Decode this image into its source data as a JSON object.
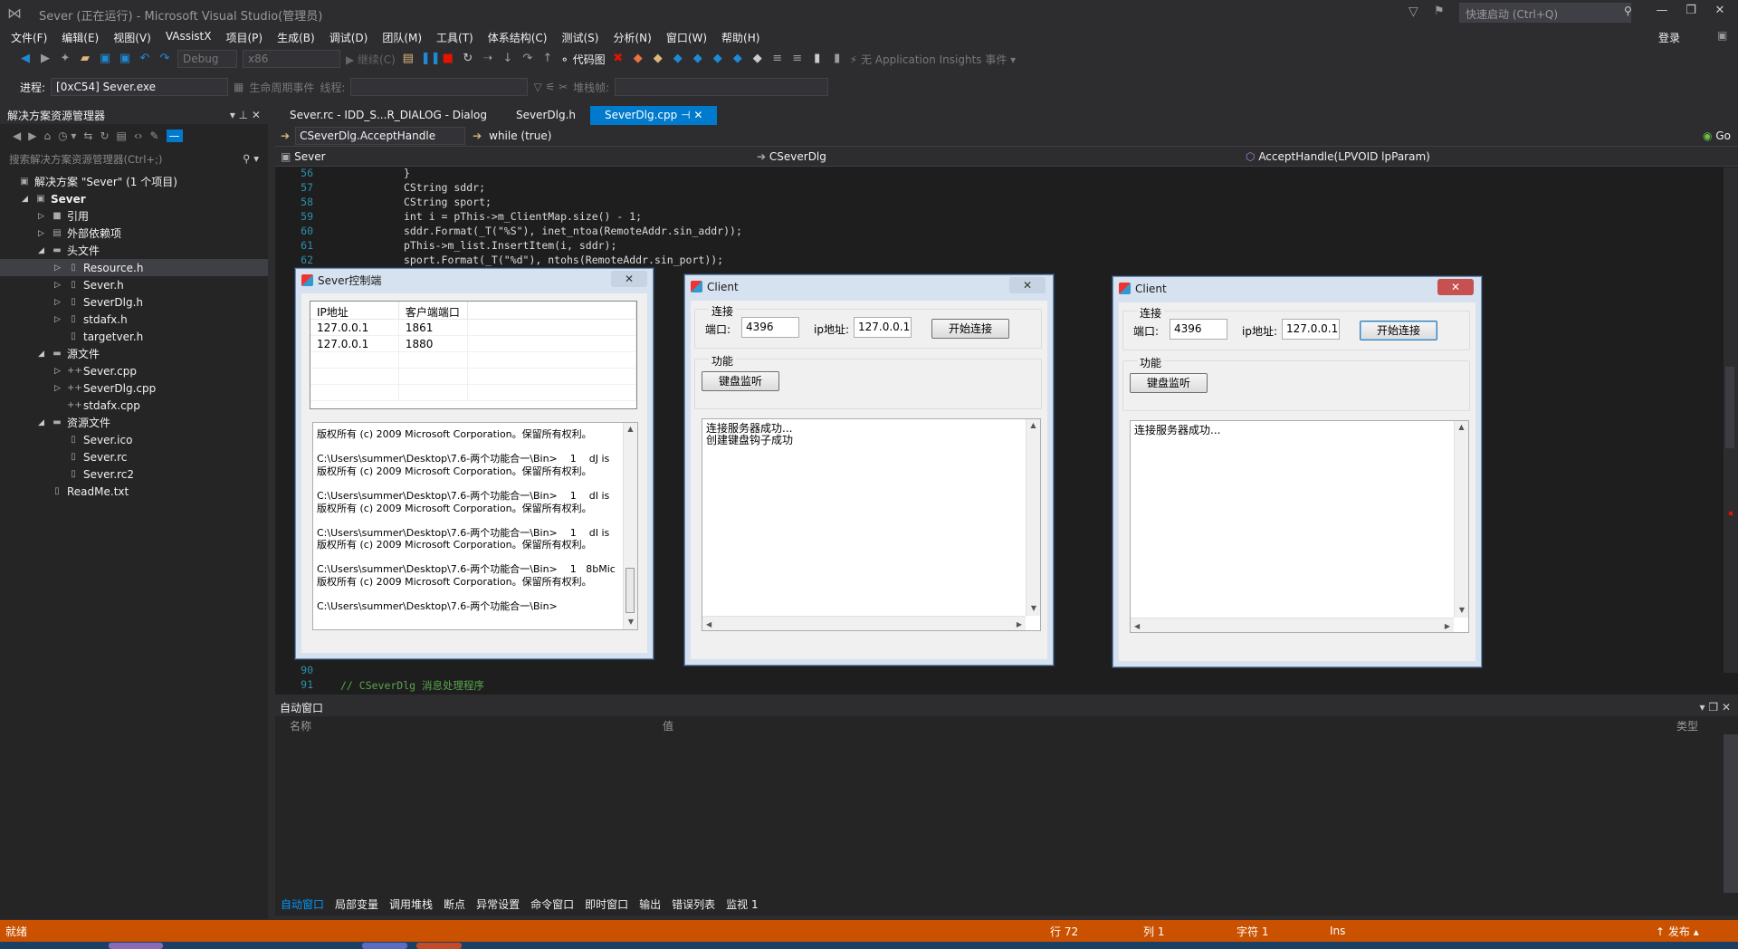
{
  "window": {
    "title": "Sever (正在运行) - Microsoft Visual Studio(管理员)",
    "quick_launch": "快速启动 (Ctrl+Q)",
    "login": "登录"
  },
  "menu": [
    "文件(F)",
    "编辑(E)",
    "视图(V)",
    "VAssistX",
    "项目(P)",
    "生成(B)",
    "调试(D)",
    "团队(M)",
    "工具(T)",
    "体系结构(C)",
    "测试(S)",
    "分析(N)",
    "窗口(W)",
    "帮助(H)"
  ],
  "toolbar": {
    "config": "Debug",
    "platform": "x86",
    "continue": "继续(C)",
    "code_map": "代码图",
    "insights": "无 Application Insights 事件"
  },
  "process": {
    "label": "进程:",
    "value": "[0xC54] Sever.exe",
    "lifecycle": "生命周期事件",
    "thread": "线程:",
    "stack": "堆栈帧:"
  },
  "solution": {
    "title": "解决方案资源管理器",
    "search": "搜索解决方案资源管理器(Ctrl+;)",
    "tree": [
      {
        "label": "解决方案 \"Sever\" (1 个项目)",
        "depth": 0,
        "arrow": "",
        "icon": "▣"
      },
      {
        "label": "Sever",
        "depth": 1,
        "arrow": "◢",
        "icon": "▣"
      },
      {
        "label": "引用",
        "depth": 2,
        "arrow": "▷",
        "icon": "■"
      },
      {
        "label": "外部依赖项",
        "depth": 2,
        "arrow": "▷",
        "icon": "▤"
      },
      {
        "label": "头文件",
        "depth": 2,
        "arrow": "◢",
        "icon": "▬"
      },
      {
        "label": "Resource.h",
        "depth": 3,
        "arrow": "▷",
        "icon": "▯",
        "sel": true
      },
      {
        "label": "Sever.h",
        "depth": 3,
        "arrow": "▷",
        "icon": "▯"
      },
      {
        "label": "SeverDlg.h",
        "depth": 3,
        "arrow": "▷",
        "icon": "▯"
      },
      {
        "label": "stdafx.h",
        "depth": 3,
        "arrow": "▷",
        "icon": "▯"
      },
      {
        "label": "targetver.h",
        "depth": 3,
        "arrow": "",
        "icon": "▯"
      },
      {
        "label": "源文件",
        "depth": 2,
        "arrow": "◢",
        "icon": "▬"
      },
      {
        "label": "Sever.cpp",
        "depth": 3,
        "arrow": "▷",
        "icon": "++"
      },
      {
        "label": "SeverDlg.cpp",
        "depth": 3,
        "arrow": "▷",
        "icon": "++"
      },
      {
        "label": "stdafx.cpp",
        "depth": 3,
        "arrow": "",
        "icon": "++"
      },
      {
        "label": "资源文件",
        "depth": 2,
        "arrow": "◢",
        "icon": "▬"
      },
      {
        "label": "Sever.ico",
        "depth": 3,
        "arrow": "",
        "icon": "▯"
      },
      {
        "label": "Sever.rc",
        "depth": 3,
        "arrow": "",
        "icon": "▯"
      },
      {
        "label": "Sever.rc2",
        "depth": 3,
        "arrow": "",
        "icon": "▯"
      },
      {
        "label": "ReadMe.txt",
        "depth": 2,
        "arrow": "",
        "icon": "▯"
      }
    ]
  },
  "editor": {
    "tabs": [
      "Sever.rc - IDD_S...R_DIALOG - Dialog",
      "SeverDlg.h",
      "SeverDlg.cpp"
    ],
    "nav_left": "CSeverDlg.AcceptHandle",
    "nav_right": "while (true)",
    "go": "Go",
    "scope": "Sever",
    "class": "CSeverDlg",
    "method": "AcceptHandle(LPVOID lpParam)",
    "lines": [
      {
        "n": "56",
        "t": "}"
      },
      {
        "n": "57",
        "t": "CString sddr;"
      },
      {
        "n": "58",
        "t": "CString sport;"
      },
      {
        "n": "59",
        "t": "int i = pThis->m_ClientMap.size() - 1;"
      },
      {
        "n": "60",
        "t": "sddr.Format(_T(\"%S\"), inet_ntoa(RemoteAddr.sin_addr));"
      },
      {
        "n": "61",
        "t": "pThis->m_list.InsertItem(i, sddr);"
      },
      {
        "n": "62",
        "t": "sport.Format(_T(\"%d\"), ntohs(RemoteAddr.sin_port));"
      }
    ],
    "line90": "90",
    "line91": "91",
    "comment91": "// CSeverDlg 消息处理程序"
  },
  "autos": {
    "title": "自动窗口",
    "col_name": "名称",
    "col_value": "值",
    "col_type": "类型"
  },
  "bottom_tabs": [
    "自动窗口",
    "局部变量",
    "调用堆栈",
    "断点",
    "异常设置",
    "命令窗口",
    "即时窗口",
    "输出",
    "错误列表",
    "监视 1"
  ],
  "status": {
    "ready": "就绪",
    "line": "行 72",
    "col": "列 1",
    "char": "字符 1",
    "ins": "Ins",
    "publish": "发布"
  },
  "server_dlg": {
    "title": "Sever控制端",
    "columns": [
      "IP地址",
      "客户端端口"
    ],
    "rows": [
      [
        "127.0.0.1",
        "1861"
      ],
      [
        "127.0.0.1",
        "1880"
      ]
    ],
    "log": [
      "版权所有 (c) 2009 Microsoft Corporation。保留所有权利。",
      "",
      "C:\\Users\\summer\\Desktop\\7.6-两个功能合一\\Bin>    1    dJ is",
      "版权所有 (c) 2009 Microsoft Corporation。保留所有权利。",
      "",
      "C:\\Users\\summer\\Desktop\\7.6-两个功能合一\\Bin>    1    dI is",
      "版权所有 (c) 2009 Microsoft Corporation。保留所有权利。",
      "",
      "C:\\Users\\summer\\Desktop\\7.6-两个功能合一\\Bin>    1    dI is",
      "版权所有 (c) 2009 Microsoft Corporation。保留所有权利。",
      "",
      "C:\\Users\\summer\\Desktop\\7.6-两个功能合一\\Bin>    1   8bMic",
      "版权所有 (c) 2009 Microsoft Corporation。保留所有权利。",
      "",
      "C:\\Users\\summer\\Desktop\\7.6-两个功能合一\\Bin>"
    ]
  },
  "client1": {
    "title": "Client",
    "group_conn": "连接",
    "port_label": "端口:",
    "port": "4396",
    "ip_label": "ip地址:",
    "ip": "127.0.0.1",
    "connect_btn": "开始连接",
    "group_func": "功能",
    "kb_btn": "键盘监听",
    "log": [
      "连接服务器成功...",
      "创建键盘钩子成功"
    ]
  },
  "client2": {
    "title": "Client",
    "group_conn": "连接",
    "port_label": "端口:",
    "port": "4396",
    "ip_label": "ip地址:",
    "ip": "127.0.0.1",
    "connect_btn": "开始连接",
    "group_func": "功能",
    "kb_btn": "键盘监听",
    "log": [
      "连接服务器成功..."
    ]
  },
  "colors": {
    "accent": "#007acc",
    "status_bar": "#ca5100",
    "ide_bg": "#2d2d30"
  }
}
